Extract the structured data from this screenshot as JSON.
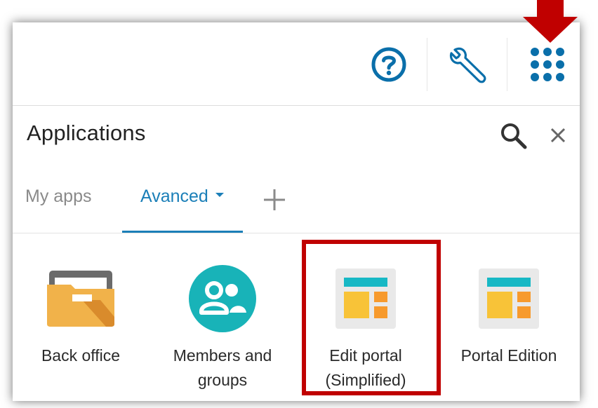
{
  "header": {
    "title": "Applications"
  },
  "toolbar": {
    "help_icon": "question-circle",
    "settings_icon": "wrench",
    "apps_icon": "grid-dots"
  },
  "tabs": [
    {
      "label": "My apps",
      "active": false
    },
    {
      "label": "Avanced",
      "active": true,
      "has_dropdown": true
    }
  ],
  "apps": [
    {
      "label_line1": "Back office",
      "label_line2": "",
      "icon": "folder-icon"
    },
    {
      "label_line1": "Members and",
      "label_line2": "groups",
      "icon": "members-icon"
    },
    {
      "label_line1": "Edit portal",
      "label_line2": "(Simplified)",
      "icon": "portal-layout-icon"
    },
    {
      "label_line1": "Portal Edition",
      "label_line2": "",
      "icon": "portal-layout-icon"
    }
  ],
  "colors": {
    "accent": "#1b7fb8",
    "icon_blue": "#0a6faa",
    "highlight": "#c00000",
    "members_teal": "#18b3b8",
    "folder_orange": "#f1b24a",
    "portal_teal": "#17b8c5",
    "portal_yellow": "#f8c338",
    "portal_orange": "#f79a2d"
  }
}
